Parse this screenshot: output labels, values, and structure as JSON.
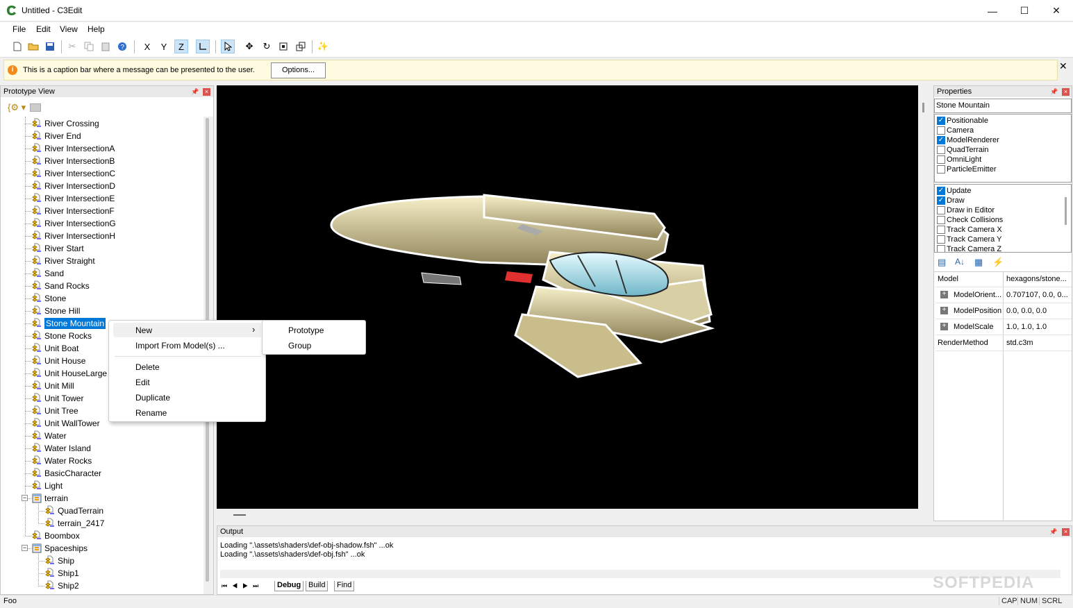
{
  "window": {
    "title": "Untitled - C3Edit",
    "minimize": "—",
    "maximize": "☐",
    "close": "✕"
  },
  "menu": [
    "File",
    "Edit",
    "View",
    "Help"
  ],
  "toolbar": {
    "x": "X",
    "y": "Y",
    "z": "Z"
  },
  "caption": {
    "message": "This is a caption bar where a message can be presented to the user.",
    "options": "Options...",
    "info_icon": "i",
    "close": "✕"
  },
  "prototype_view": {
    "title": "Prototype View",
    "items": [
      {
        "label": "River Crossing",
        "level": 1
      },
      {
        "label": "River End",
        "level": 1
      },
      {
        "label": "River IntersectionA",
        "level": 1
      },
      {
        "label": "River IntersectionB",
        "level": 1
      },
      {
        "label": "River IntersectionC",
        "level": 1
      },
      {
        "label": "River IntersectionD",
        "level": 1
      },
      {
        "label": "River IntersectionE",
        "level": 1
      },
      {
        "label": "River IntersectionF",
        "level": 1
      },
      {
        "label": "River IntersectionG",
        "level": 1
      },
      {
        "label": "River IntersectionH",
        "level": 1
      },
      {
        "label": "River Start",
        "level": 1
      },
      {
        "label": "River Straight",
        "level": 1
      },
      {
        "label": "Sand",
        "level": 1
      },
      {
        "label": "Sand Rocks",
        "level": 1
      },
      {
        "label": "Stone",
        "level": 1
      },
      {
        "label": "Stone Hill",
        "level": 1
      },
      {
        "label": "Stone Mountain",
        "level": 1,
        "selected": true
      },
      {
        "label": "Stone Rocks",
        "level": 1
      },
      {
        "label": "Unit Boat",
        "level": 1
      },
      {
        "label": "Unit House",
        "level": 1
      },
      {
        "label": "Unit HouseLarge",
        "level": 1
      },
      {
        "label": "Unit Mill",
        "level": 1
      },
      {
        "label": "Unit Tower",
        "level": 1
      },
      {
        "label": "Unit Tree",
        "level": 1
      },
      {
        "label": "Unit WallTower",
        "level": 1
      },
      {
        "label": "Water",
        "level": 1
      },
      {
        "label": "Water Island",
        "level": 1
      },
      {
        "label": "Water Rocks",
        "level": 1
      },
      {
        "label": "BasicCharacter",
        "level": 1
      },
      {
        "label": "Light",
        "level": 1
      },
      {
        "label": "terrain",
        "level": 1,
        "group": true,
        "expander": "−"
      },
      {
        "label": "QuadTerrain",
        "level": 2
      },
      {
        "label": "terrain_2417",
        "level": 2
      },
      {
        "label": "Boombox",
        "level": 1
      },
      {
        "label": "Spaceships",
        "level": 1,
        "group": true,
        "expander": "−"
      },
      {
        "label": "Ship",
        "level": 2
      },
      {
        "label": "Ship1",
        "level": 2
      },
      {
        "label": "Ship2",
        "level": 2
      }
    ]
  },
  "context_menu": {
    "items": [
      "New",
      "Import From Model(s) ...",
      "Delete",
      "Edit",
      "Duplicate",
      "Rename"
    ],
    "submenu_arrow": "›",
    "submenu": [
      "Prototype",
      "Group"
    ]
  },
  "properties": {
    "title": "Properties",
    "object_name": "Stone Mountain",
    "components": [
      {
        "label": "Positionable",
        "checked": true
      },
      {
        "label": "Camera",
        "checked": false
      },
      {
        "label": "ModelRenderer",
        "checked": true
      },
      {
        "label": "QuadTerrain",
        "checked": false
      },
      {
        "label": "OmniLight",
        "checked": false
      },
      {
        "label": "ParticleEmitter",
        "checked": false
      }
    ],
    "flags": [
      {
        "label": "Update",
        "checked": true
      },
      {
        "label": "Draw",
        "checked": true
      },
      {
        "label": "Draw in Editor",
        "checked": false
      },
      {
        "label": "Check Collisions",
        "checked": false
      },
      {
        "label": "Track Camera X",
        "checked": false
      },
      {
        "label": "Track Camera Y",
        "checked": false
      },
      {
        "label": "Track Camera Z",
        "checked": false
      }
    ],
    "grid": [
      {
        "key": "Model",
        "value": "hexagons/stone...",
        "expandable": false
      },
      {
        "key": "ModelOrient...",
        "value": "0.707107, 0.0, 0...",
        "expandable": true
      },
      {
        "key": "ModelPosition",
        "value": "0.0, 0.0, 0.0",
        "expandable": true
      },
      {
        "key": "ModelScale",
        "value": "1.0, 1.0, 1.0",
        "expandable": true
      },
      {
        "key": "RenderMethod",
        "value": "std.c3m",
        "expandable": false
      }
    ],
    "expander": "+"
  },
  "output": {
    "title": "Output",
    "lines": [
      "Loading \".\\assets\\shaders\\def-obj-shadow.fsh\" ...ok",
      "Loading \".\\assets\\shaders\\def-obj.fsh\" ...ok"
    ],
    "tabs": [
      "Debug",
      "Build",
      "Find"
    ]
  },
  "status": {
    "text": "Foo",
    "cap": "CAP",
    "num": "NUM",
    "scrl": "SCRL"
  },
  "watermark": "SOFTPEDIA",
  "panel_close": "×",
  "colors": {
    "selection": "#0078d7",
    "caption_bg": "#fffbe1",
    "viewport": "#000000"
  }
}
